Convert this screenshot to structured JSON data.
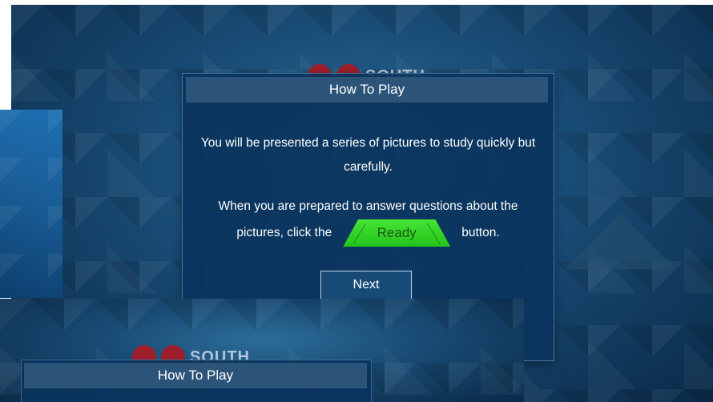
{
  "logo": {
    "text": "SOUTH"
  },
  "dialog": {
    "title": "How To Play",
    "paragraph1": "You will be presented a series of pictures to study quickly but carefully.",
    "paragraph2_line1": "When you are prepared to answer questions about the",
    "paragraph2_prefix": "pictures, click the",
    "ready_label": "Ready",
    "paragraph2_suffix": "button.",
    "next_label": "Next"
  },
  "background_dialog": {
    "title": "How To Play"
  },
  "colors": {
    "background": "#184a73",
    "dialog": "#0a345c",
    "header": "#2c5478",
    "ready_green": "#33d426",
    "logo_red": "#9f1e2c"
  }
}
